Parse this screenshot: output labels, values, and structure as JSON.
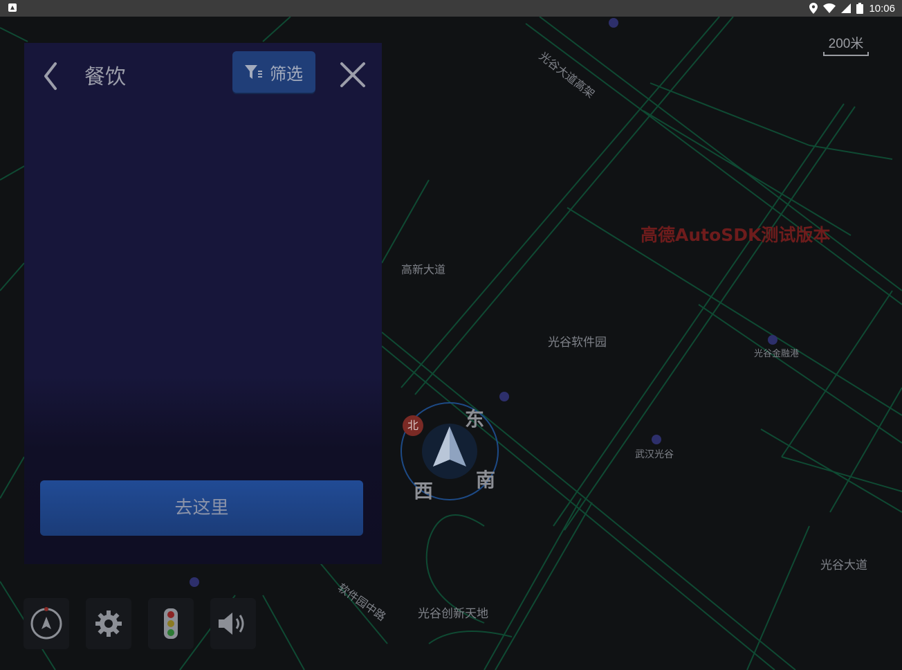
{
  "status_bar": {
    "time": "10:06"
  },
  "panel": {
    "title": "餐饮",
    "filter_label": "筛选",
    "go_label": "去这里"
  },
  "map": {
    "scale_label": "200米",
    "watermark": "高德AutoSDK测试版本",
    "labels": {
      "road_guanggu": "光谷大道高架",
      "road_software": "软件园中路",
      "place_a": "高新大道",
      "place_b": "光谷软件园",
      "place_c": "光谷金融港",
      "place_d": "武汉光谷",
      "place_e": "光谷大道",
      "place_f": "光谷创新天地"
    },
    "compass": {
      "north": "北",
      "east": "东",
      "south": "南",
      "west": "西"
    }
  },
  "toolbar": {
    "buttons": [
      "compass-icon",
      "gear-icon",
      "traffic-light-icon",
      "volume-icon"
    ]
  }
}
